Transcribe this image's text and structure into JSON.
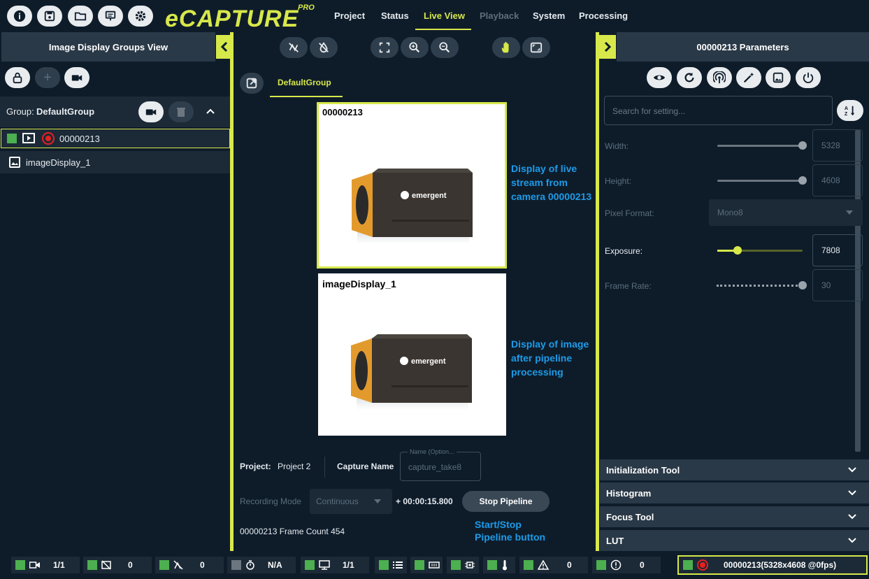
{
  "app": {
    "logo_text": "eCAPTURE",
    "logo_badge": "PRO"
  },
  "menu": {
    "project": "Project",
    "status": "Status",
    "live_view": "Live View",
    "playback": "Playback",
    "system": "System",
    "processing": "Processing"
  },
  "left_panel": {
    "title": "Image Display Groups View",
    "group_prefix": "Group:",
    "group_name": "DefaultGroup",
    "camera_item": "00000213",
    "display_item": "imageDisplay_1"
  },
  "center": {
    "tab": "DefaultGroup",
    "camera_view_label": "00000213",
    "display_view_label": "imageDisplay_1",
    "annotation_live": "Display of live stream from camera 00000213",
    "annotation_pipeline": "Display of image after pipeline processing",
    "annotation_button": "Start/Stop Pipeline button",
    "project_label": "Project:",
    "project_value": "Project 2",
    "capture_name_label": "Capture Name",
    "capture_name_legend": "Name (Option...",
    "capture_name_value": "capture_take8",
    "recording_mode_label": "Recording Mode",
    "recording_mode_value": "Continuous",
    "timer": "+ 00:00:15.800",
    "stop_pipeline": "Stop Pipeline",
    "frame_count": "00000213 Frame Count 454",
    "camera_brand": "emergent"
  },
  "right_panel": {
    "title": "00000213 Parameters",
    "search_placeholder": "Search for setting...",
    "width_label": "Width:",
    "width_value": "5328",
    "height_label": "Height:",
    "height_value": "4608",
    "pixel_format_label": "Pixel Format:",
    "pixel_format_value": "Mono8",
    "exposure_label": "Exposure:",
    "exposure_value": "7808",
    "frame_rate_label": "Frame Rate:",
    "frame_rate_value": "30",
    "accordions": [
      "Initialization Tool",
      "Histogram",
      "Focus Tool",
      "LUT"
    ]
  },
  "statusbar": {
    "cameras": "1/1",
    "no_signal": "0",
    "not_connected": "0",
    "timer": "N/A",
    "displays": "1/1",
    "warnings": "0",
    "errors": "0",
    "camera_status": "00000213(5328x4608 @0fps)"
  },
  "colors": {
    "accent": "#d7e84a",
    "background": "#0e1c2a",
    "panel": "#2a3947",
    "annotation": "#1e9be8",
    "status_green": "#4caf50"
  }
}
